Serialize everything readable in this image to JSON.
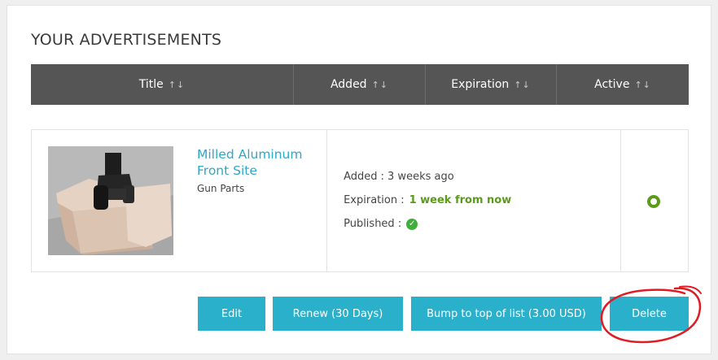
{
  "section": {
    "heading": "YOUR ADVERTISEMENTS"
  },
  "table": {
    "columns": [
      {
        "label": "Title",
        "sort": "↑↓"
      },
      {
        "label": "Added",
        "sort": "↑↓"
      },
      {
        "label": "Expiration",
        "sort": "↑↓"
      },
      {
        "label": "Active",
        "sort": "↑↓"
      }
    ]
  },
  "listing": {
    "title": "Milled Aluminum Front Site",
    "category": "Gun Parts",
    "added_label": "Added :",
    "added_value": "3 weeks ago",
    "expiration_label": "Expiration :",
    "expiration_value": "1 week from now",
    "published_label": "Published :",
    "published_icon": "check-icon",
    "active_icon": "active-status-icon"
  },
  "actions": {
    "edit": "Edit",
    "renew": "Renew (30 Days)",
    "bump": "Bump to top of list (3.00 USD)",
    "delete": "Delete"
  },
  "colors": {
    "header_bg": "#555555",
    "accent": "#2bb0cc",
    "title_link": "#2ea7c8",
    "expiration_green": "#5a9b1a",
    "highlight_circle": "#e01b24"
  }
}
